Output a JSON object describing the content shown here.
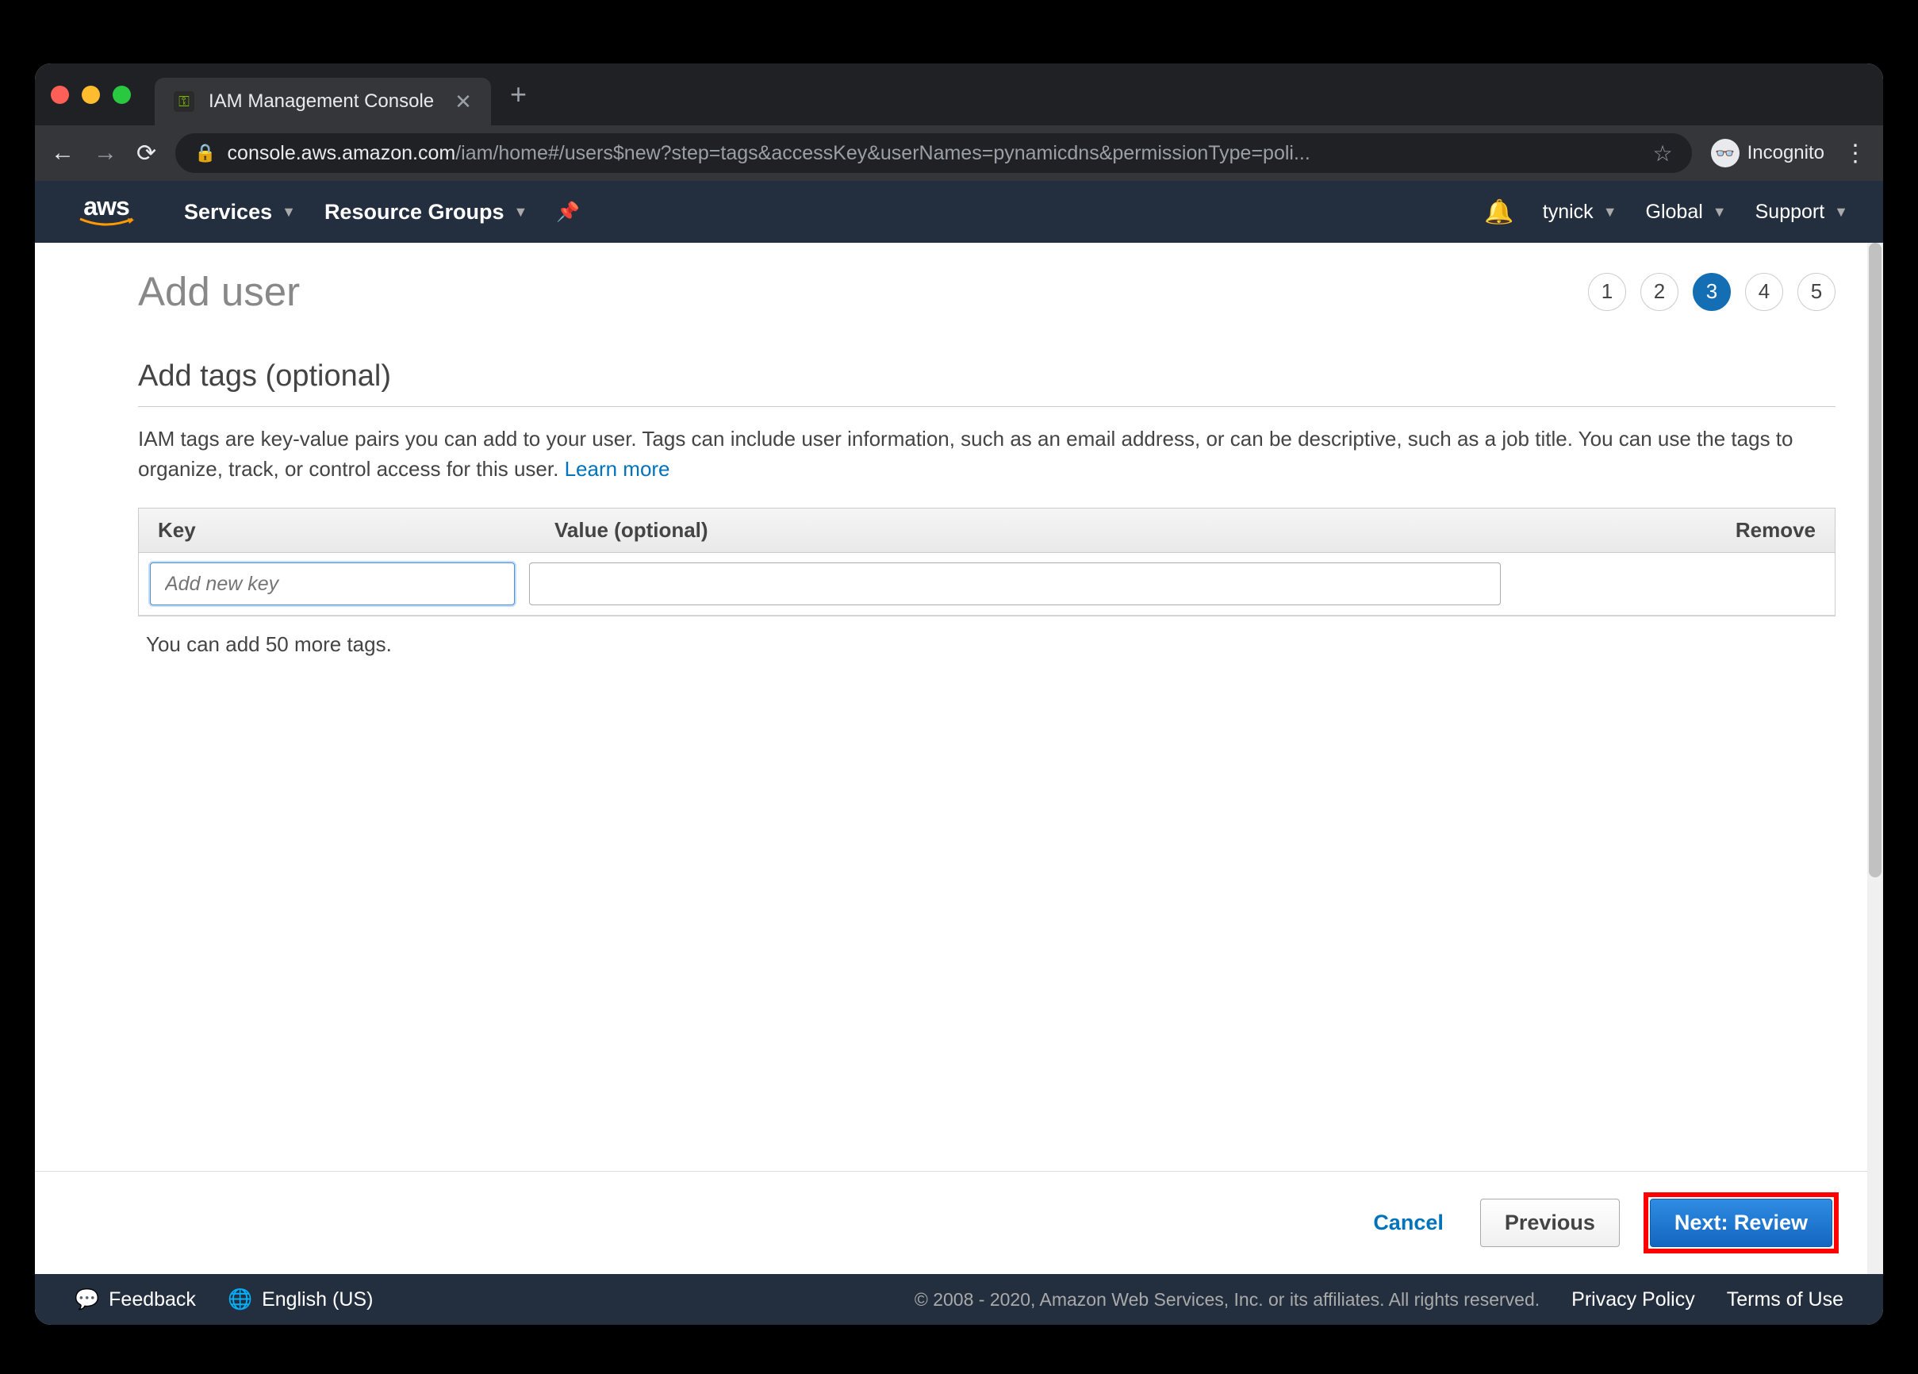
{
  "browser": {
    "tab_title": "IAM Management Console",
    "url_host": "console.aws.amazon.com",
    "url_path": "/iam/home#/users$new?step=tags&accessKey&userNames=pynamicdns&permissionType=poli...",
    "incognito_label": "Incognito"
  },
  "navbar": {
    "logo": "aws",
    "services": "Services",
    "resource_groups": "Resource Groups",
    "account": "tynick",
    "region": "Global",
    "support": "Support"
  },
  "page": {
    "title": "Add user",
    "steps": [
      "1",
      "2",
      "3",
      "4",
      "5"
    ],
    "active_step": 3,
    "section_title": "Add tags (optional)",
    "section_desc": "IAM tags are key-value pairs you can add to your user. Tags can include user information, such as an email address, or can be descriptive, such as a job title. You can use the tags to organize, track, or control access for this user. ",
    "learn_more": "Learn more",
    "table": {
      "col_key": "Key",
      "col_value": "Value (optional)",
      "col_remove": "Remove",
      "key_placeholder": "Add new key",
      "value_placeholder": ""
    },
    "tag_hint": "You can add 50 more tags.",
    "buttons": {
      "cancel": "Cancel",
      "previous": "Previous",
      "next": "Next: Review"
    }
  },
  "footer": {
    "feedback": "Feedback",
    "language": "English (US)",
    "copyright": "© 2008 - 2020, Amazon Web Services, Inc. or its affiliates. All rights reserved.",
    "privacy": "Privacy Policy",
    "terms": "Terms of Use"
  }
}
